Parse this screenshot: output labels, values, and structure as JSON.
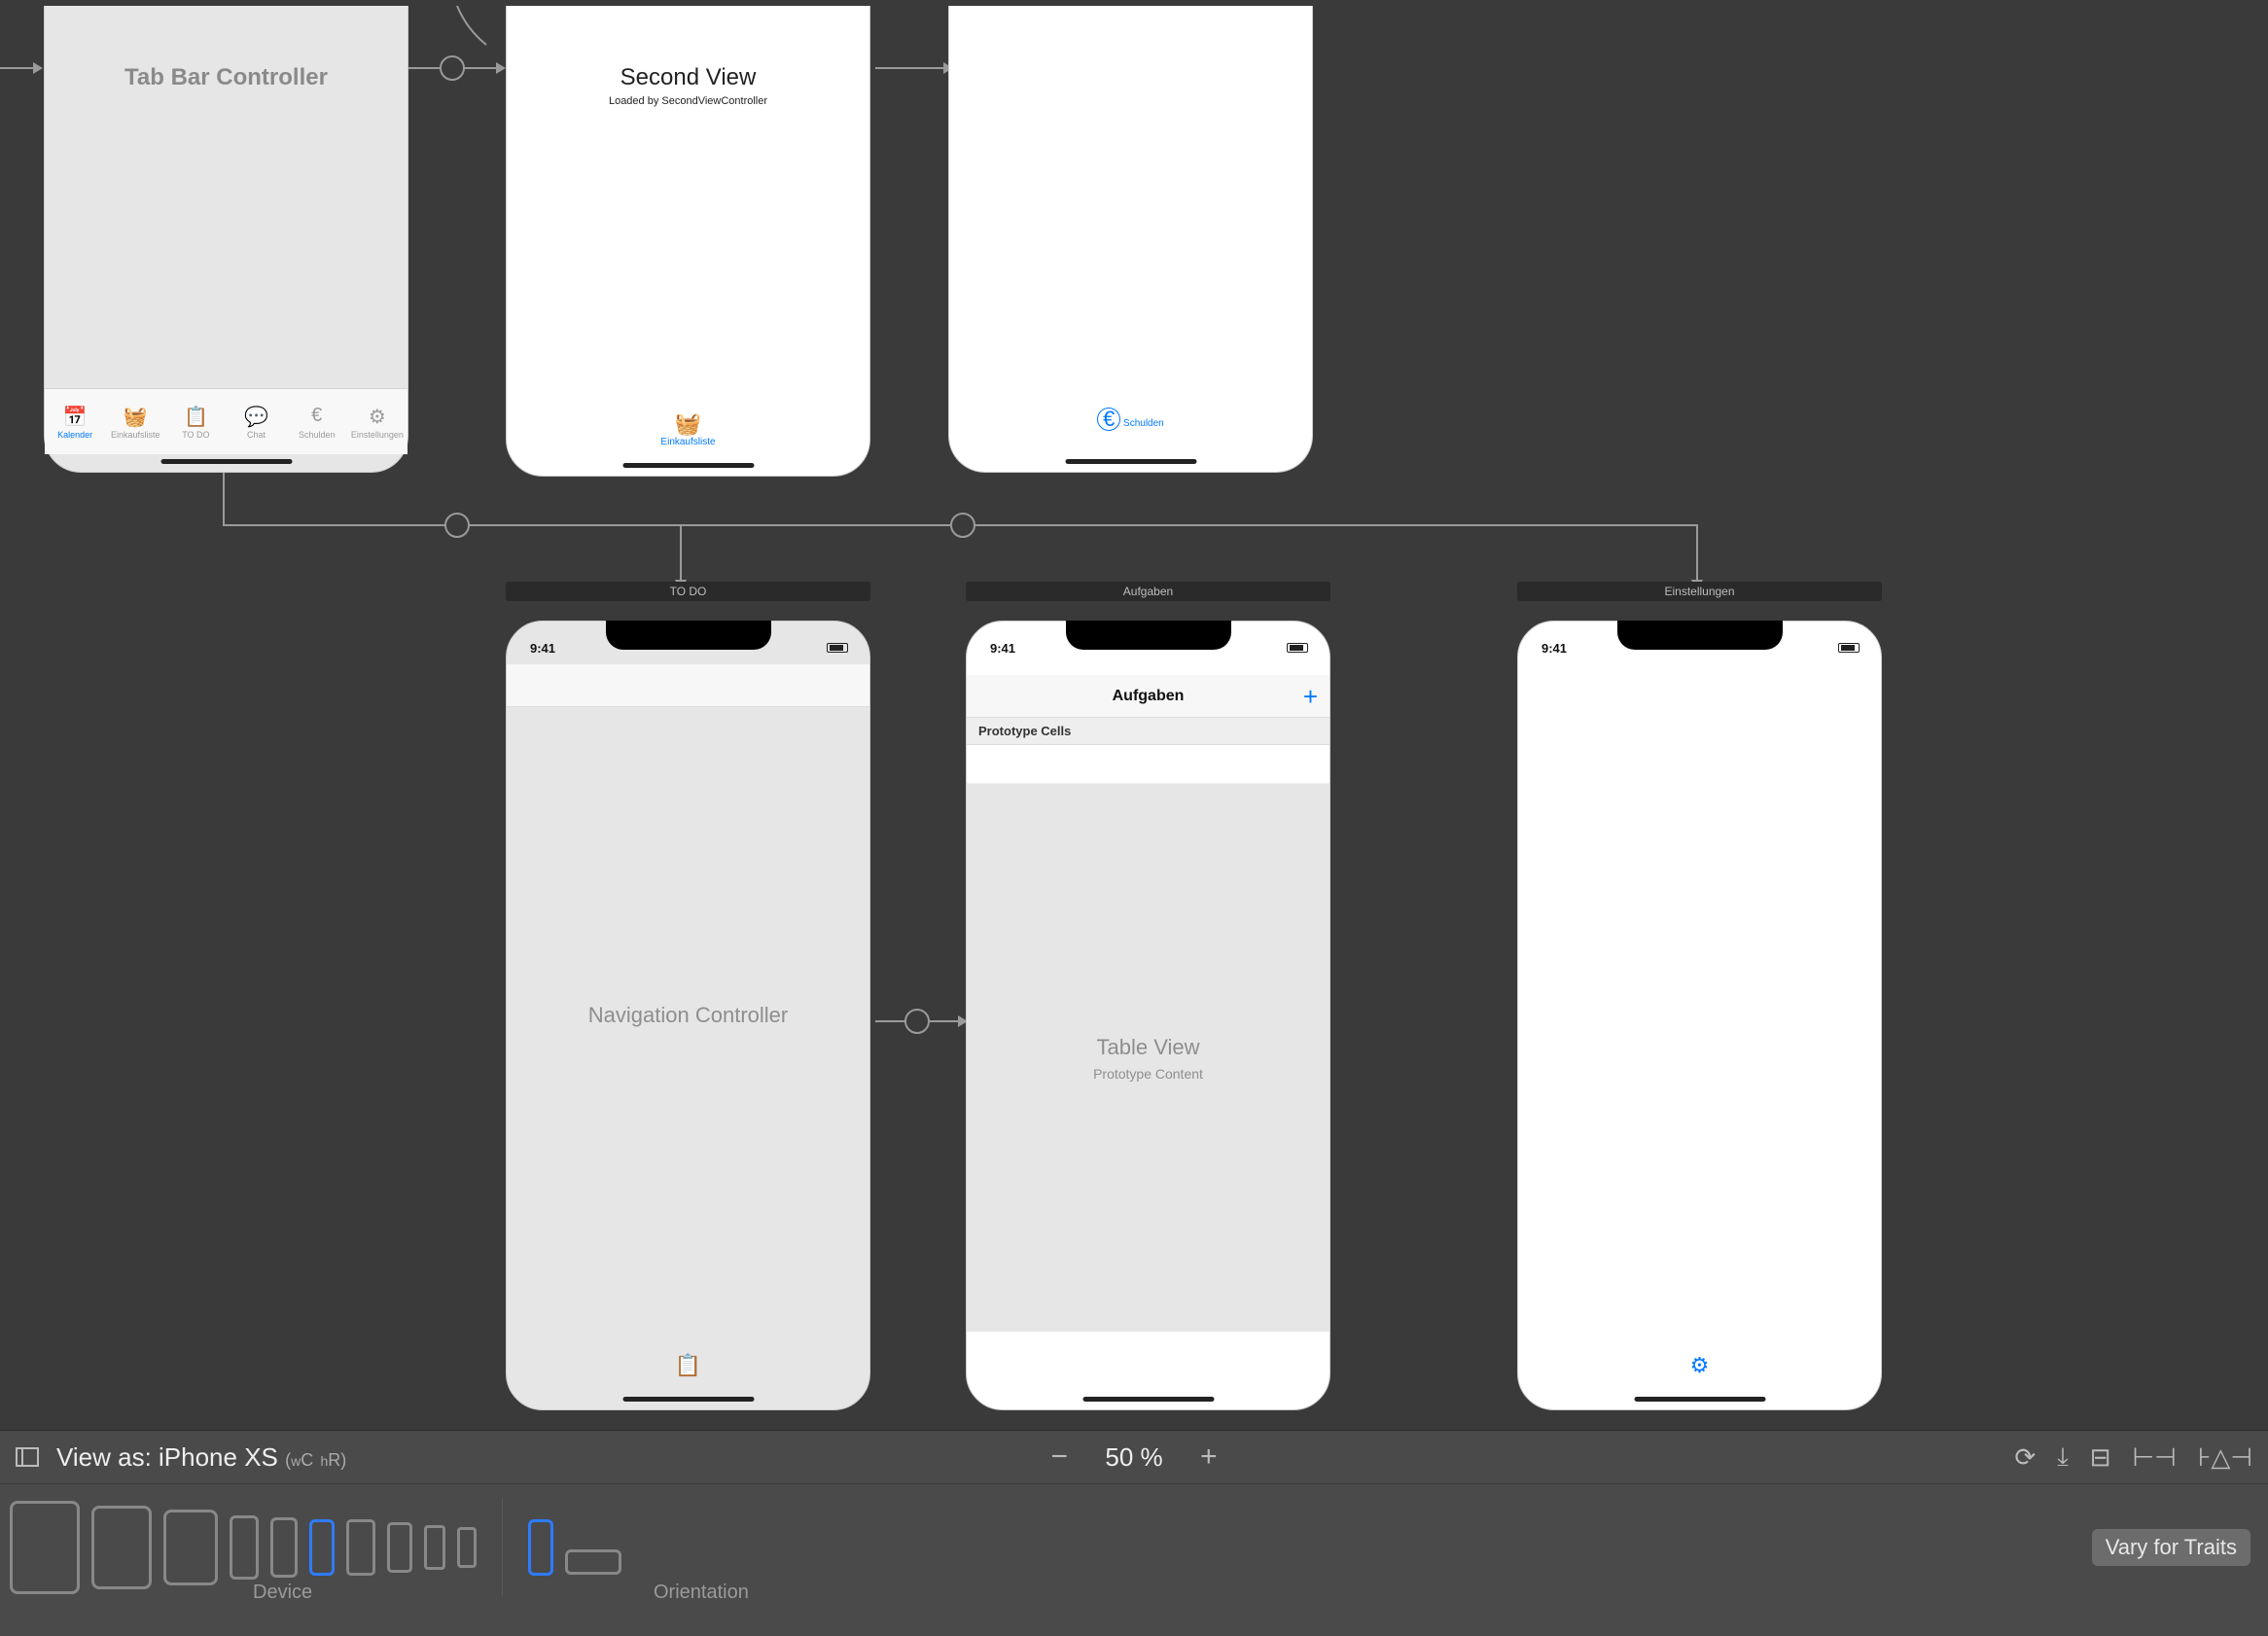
{
  "canvas": {
    "scene1": {
      "title": "Tab Bar Controller",
      "tabs": [
        {
          "icon": "📅",
          "label": "Kalender",
          "active": true
        },
        {
          "icon": "🧺",
          "label": "Einkaufsliste",
          "active": false
        },
        {
          "icon": "📋",
          "label": "TO DO",
          "active": false
        },
        {
          "icon": "💬",
          "label": "Chat",
          "active": false
        },
        {
          "icon": "€",
          "label": "Schulden",
          "active": false
        },
        {
          "icon": "⚙︎",
          "label": "Einstellungen",
          "active": false
        }
      ]
    },
    "scene2": {
      "title": "Second View",
      "subtitle": "Loaded by SecondViewController",
      "tab": {
        "icon": "🧺",
        "label": "Einkaufsliste"
      }
    },
    "scene3": {
      "tab": {
        "icon": "€",
        "label": "Schulden"
      }
    },
    "scene4": {
      "header": "TO DO",
      "status_time": "9:41",
      "center": "Navigation Controller",
      "tab_icon": "📋"
    },
    "scene5": {
      "header": "Aufgaben",
      "status_time": "9:41",
      "nav_title": "Aufgaben",
      "plus": "+",
      "prototype_label": "Prototype Cells",
      "center_title": "Table View",
      "center_sub": "Prototype Content"
    },
    "scene6": {
      "header": "Einstellungen",
      "status_time": "9:41",
      "tab_icon": "⚙︎"
    }
  },
  "bottombar": {
    "view_as_label": "View as: iPhone XS",
    "trait_w_prefix": "w",
    "trait_w": "C",
    "trait_h_prefix": "h",
    "trait_h": "R",
    "zoom_value": "50 %",
    "device_caption": "Device",
    "orientation_caption": "Orientation",
    "vary_label": "Vary for Traits"
  }
}
